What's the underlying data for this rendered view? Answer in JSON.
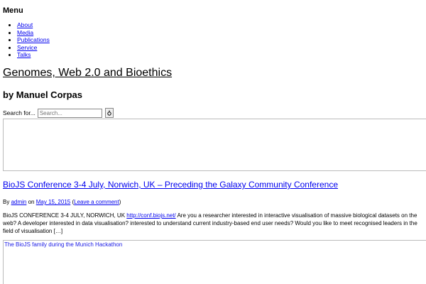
{
  "menu": {
    "heading": "Menu",
    "items": [
      {
        "label": "About"
      },
      {
        "label": "Media"
      },
      {
        "label": "Publications"
      },
      {
        "label": "Service"
      },
      {
        "label": "Talks"
      }
    ]
  },
  "site": {
    "title": "Genomes, Web 2.0 and Bioethics",
    "author_line": "by Manuel Corpas"
  },
  "search": {
    "label": "Search for...",
    "placeholder": "Search..."
  },
  "post": {
    "title": "BioJS Conference 3-4 July, Norwich, UK – Preceding the Galaxy Community Conference",
    "meta_by": "By",
    "author": "admin",
    "meta_on": "on",
    "date": "May 15, 2015",
    "comment_open": "(",
    "comment_link": "Leave a comment",
    "comment_close": ")",
    "excerpt_start": "BioJS CONFERENCE 3-4 JULY, NORWICH, UK",
    "excerpt_link": "http://conf.biojs.net/",
    "excerpt_rest": "Are you a researcher interested in interactive visualisation of massive biological datasets on the web? A developer interested in data visualisation? interested to understand current industry-based end user needs? Would you like to meet recognised leaders in the field of visualisation […]",
    "figure_caption": "The BioJS family during the Munich Hackathon"
  }
}
